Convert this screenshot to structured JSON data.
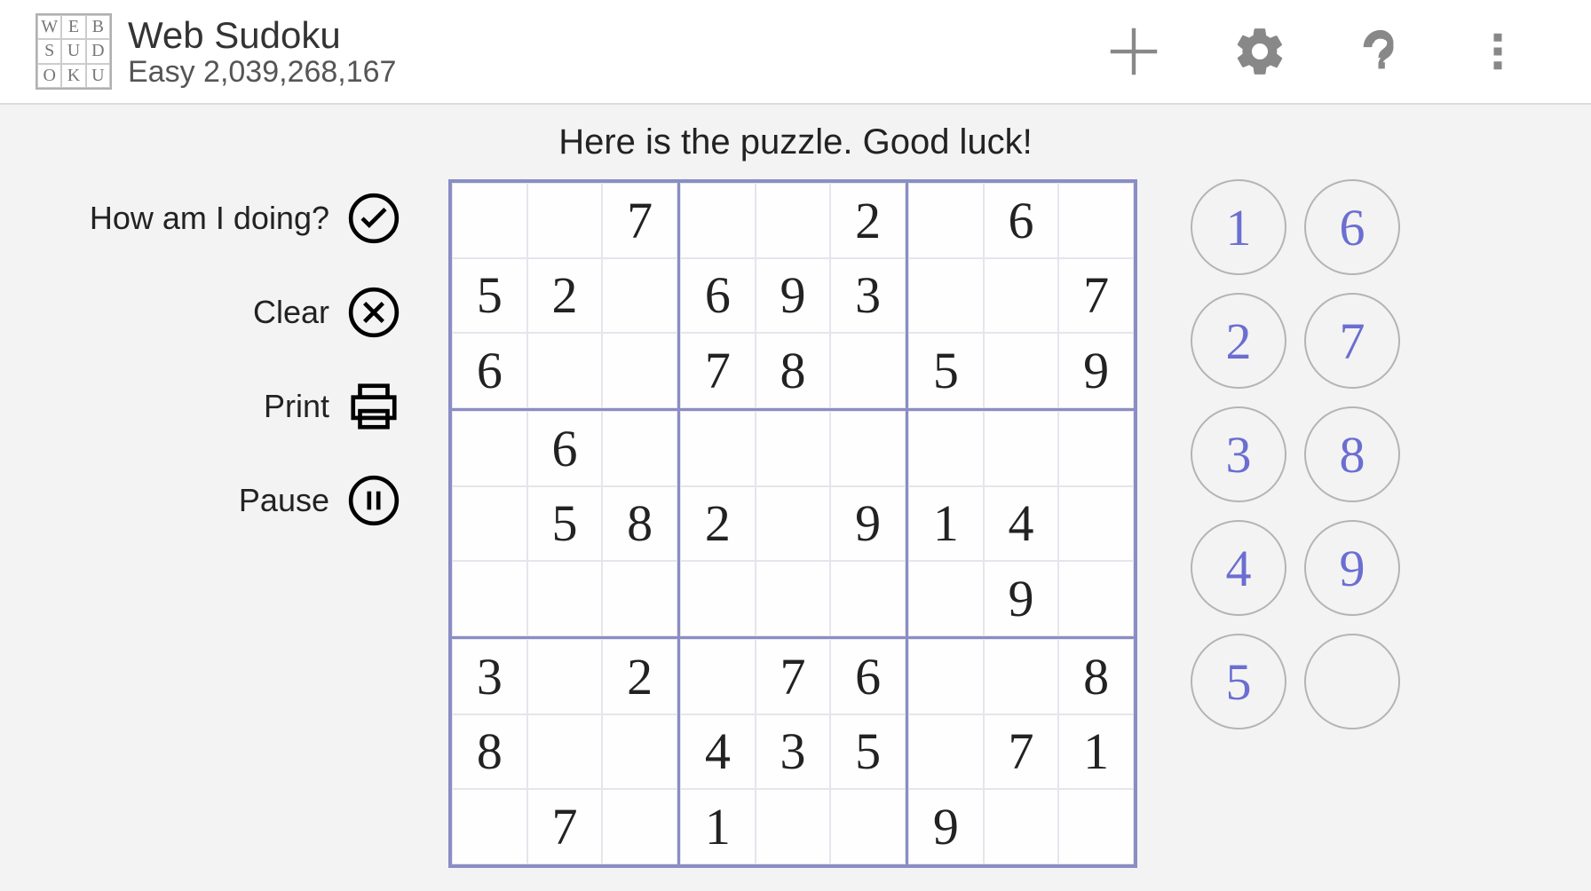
{
  "header": {
    "logo_letters": [
      "W",
      "E",
      "B",
      "S",
      "U",
      "D",
      "O",
      "K",
      "U"
    ],
    "title": "Web Sudoku",
    "subtitle": "Easy 2,039,268,167"
  },
  "message": "Here is the puzzle. Good luck!",
  "actions": {
    "check_label": "How am I doing?",
    "clear_label": "Clear",
    "print_label": "Print",
    "pause_label": "Pause"
  },
  "grid": [
    [
      "",
      "",
      "7",
      "",
      "",
      "2",
      "",
      "6",
      ""
    ],
    [
      "5",
      "2",
      "",
      "6",
      "9",
      "3",
      "",
      "",
      "7"
    ],
    [
      "6",
      "",
      "",
      "7",
      "8",
      "",
      "5",
      "",
      "9"
    ],
    [
      "",
      "6",
      "",
      "",
      "",
      "",
      "",
      "",
      ""
    ],
    [
      "",
      "5",
      "8",
      "2",
      "",
      "9",
      "1",
      "4",
      ""
    ],
    [
      "",
      "",
      "",
      "",
      "",
      "",
      "",
      "9",
      ""
    ],
    [
      "3",
      "",
      "2",
      "",
      "7",
      "6",
      "",
      "",
      "8"
    ],
    [
      "8",
      "",
      "",
      "4",
      "3",
      "5",
      "",
      "7",
      "1"
    ],
    [
      "",
      "7",
      "",
      "1",
      "",
      "",
      "9",
      "",
      ""
    ]
  ],
  "number_pad": [
    "1",
    "2",
    "3",
    "4",
    "5",
    "6",
    "7",
    "8",
    "9",
    ""
  ]
}
